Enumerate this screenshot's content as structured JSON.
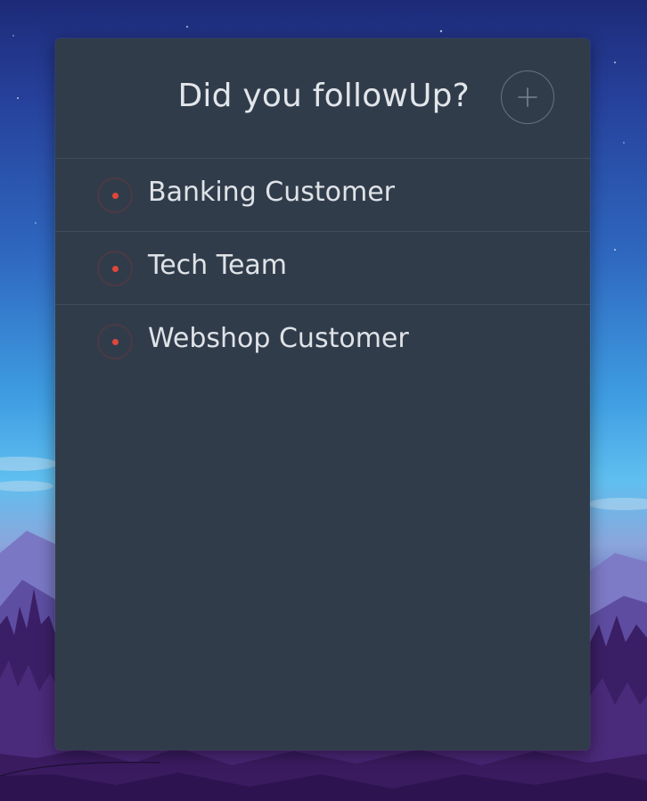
{
  "app": {
    "title": "Did you followUp?",
    "add_icon": "plus-icon"
  },
  "colors": {
    "panel_background": "#313c4b",
    "divider": "#424d5c",
    "text": "#e2e6ea",
    "status_dot": "#e0463a"
  },
  "list": {
    "items": [
      {
        "label": "Banking Customer",
        "status_icon": "record-dot-icon"
      },
      {
        "label": "Tech Team",
        "status_icon": "record-dot-icon"
      },
      {
        "label": "Webshop Customer",
        "status_icon": "record-dot-icon"
      }
    ]
  }
}
